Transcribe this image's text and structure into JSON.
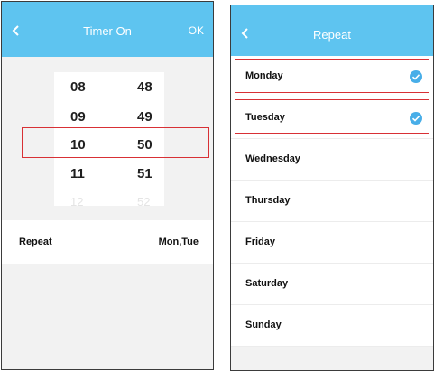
{
  "colors": {
    "header": "#5ec4f0",
    "highlight": "#d83035",
    "check": "#48aee8"
  },
  "timer_screen": {
    "title": "Timer On",
    "ok_label": "OK",
    "back_icon": "back-arrow-icon",
    "picker_rows": [
      {
        "hour": "08",
        "minute": "48"
      },
      {
        "hour": "09",
        "minute": "49"
      },
      {
        "hour": "10",
        "minute": "50"
      },
      {
        "hour": "11",
        "minute": "51"
      },
      {
        "hour": "12",
        "minute": "52"
      }
    ],
    "selected": {
      "hour": "10",
      "minute": "50"
    },
    "repeat_label": "Repeat",
    "repeat_value": "Mon,Tue"
  },
  "repeat_screen": {
    "title": "Repeat",
    "back_icon": "back-arrow-icon",
    "days": [
      {
        "label": "Monday",
        "checked": true
      },
      {
        "label": "Tuesday",
        "checked": true
      },
      {
        "label": "Wednesday",
        "checked": false
      },
      {
        "label": "Thursday",
        "checked": false
      },
      {
        "label": "Friday",
        "checked": false
      },
      {
        "label": "Saturday",
        "checked": false
      },
      {
        "label": "Sunday",
        "checked": false
      }
    ]
  }
}
